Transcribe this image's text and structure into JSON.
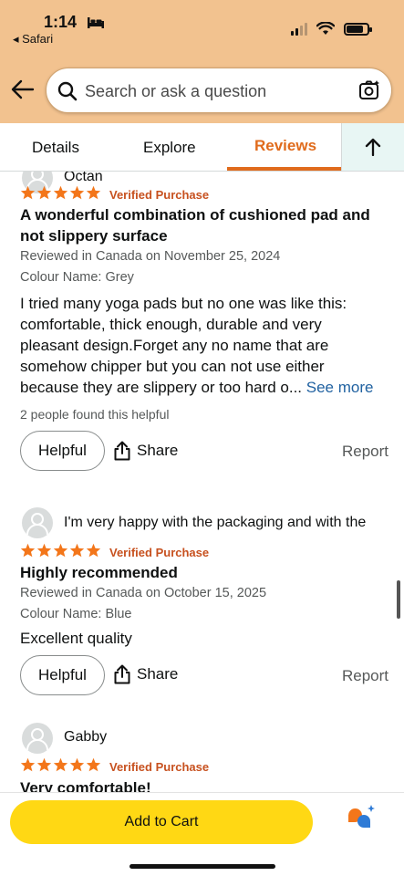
{
  "status": {
    "time": "1:14",
    "back_app": "◂ Safari"
  },
  "search": {
    "placeholder": "Search or ask a question"
  },
  "tabs": [
    {
      "label": "Details"
    },
    {
      "label": "Explore"
    },
    {
      "label": "Reviews"
    }
  ],
  "reviews": [
    {
      "author": "Octan",
      "rating": 5,
      "verified": "Verified Purchase",
      "title_line1": "A wonderful combination of cushioned pad and",
      "title_line2": "not slippery surface",
      "date": "Reviewed in Canada on November 25, 2024",
      "variant": "Colour Name: Grey",
      "body_line1": "I tried many yoga pads but no one was like this:",
      "body_line2": "comfortable, thick enough, durable and very",
      "body_line3": "pleasant design.Forget any no name that are",
      "body_line4": "somehow chipper but you can not use either",
      "body_line5": "because they are slippery or too hard o...",
      "see_more": "See more",
      "helpful_count": "2 people found this helpful"
    },
    {
      "author": "I'm very happy with the packaging and with the",
      "rating": 5,
      "verified": "Verified Purchase",
      "title_line1": "Highly recommended",
      "date": "Reviewed in Canada on October 15, 2025",
      "variant": "Colour Name: Blue",
      "body_line1": "Excellent quality"
    },
    {
      "author": "Gabby",
      "rating": 5,
      "verified": "Verified Purchase",
      "title_line1": "Very comfortable!"
    }
  ],
  "actions": {
    "helpful": "Helpful",
    "share": "Share",
    "report": "Report"
  },
  "cart": {
    "label": "Add to Cart"
  },
  "colors": {
    "accent": "#e06b1c",
    "star": "#f3761a",
    "header": "#f2c28f",
    "cart": "#ffd814",
    "link": "#2162a1"
  }
}
